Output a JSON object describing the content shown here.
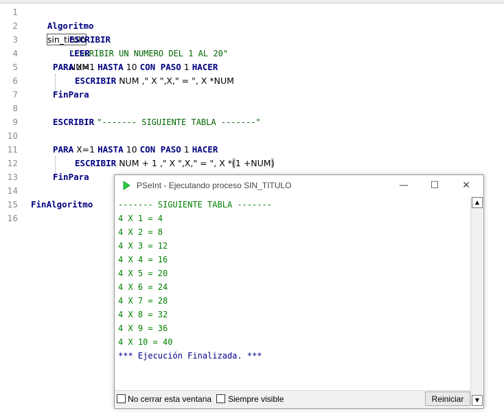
{
  "editor": {
    "lines": [
      {
        "n": "1"
      },
      {
        "n": "2"
      },
      {
        "n": "3"
      },
      {
        "n": "4"
      },
      {
        "n": "5"
      },
      {
        "n": "6"
      },
      {
        "n": "7"
      },
      {
        "n": "8"
      },
      {
        "n": "9"
      },
      {
        "n": "10"
      },
      {
        "n": "11"
      },
      {
        "n": "12"
      },
      {
        "n": "13"
      },
      {
        "n": "14"
      },
      {
        "n": "15"
      },
      {
        "n": "16"
      }
    ],
    "kw": {
      "algoritmo": "Algoritmo",
      "escribir": "ESCRIBIR",
      "leer": "LEER",
      "para": "PARA",
      "hasta": "HASTA",
      "con_paso": "CON PASO",
      "hacer": "HACER",
      "finpara": "FinPara",
      "finalgoritmo": "FinAlgoritmo"
    },
    "l1_name": "sin_titulo",
    "l2_str": "\"ESCRIBIR UN NUMERO DEL 1 AL 20\"",
    "l3_var": "NUM",
    "l5_var": "X=",
    "l5_from": "1",
    "l5_to": "10",
    "l5_step": "1",
    "l6_rest": "NUM ,\" X \",X,\" = \", X *NUM",
    "l9_str": "\"------- SIGUIENTE TABLA -------\"",
    "l11_var": "X=",
    "l11_from": "1",
    "l11_to": "10",
    "l11_step": "1",
    "l12_a": "NUM + ",
    "l12_one": "1",
    "l12_b": " ,\" X \",X,\" = \", X *",
    "l12_open": "(",
    "l12_one2": "1",
    "l12_c": " +NUM",
    "l12_close": ")"
  },
  "run_window": {
    "title": "PSeInt - Ejecutando proceso SIN_TITULO",
    "minimize": "—",
    "maximize": "☐",
    "close": "✕",
    "output": [
      "------- SIGUIENTE TABLA -------",
      "4 X 1 = 4",
      "4 X 2 = 8",
      "4 X 3 = 12",
      "4 X 4 = 16",
      "4 X 5 = 20",
      "4 X 6 = 24",
      "4 X 7 = 28",
      "4 X 8 = 32",
      "4 X 9 = 36",
      "4 X 10 = 40"
    ],
    "finished": "*** Ejecución Finalizada. ***",
    "no_cerrar": "No cerrar esta ventana",
    "siempre_visible": "Siempre visible",
    "reiniciar": "Reiniciar",
    "scroll_up": "▲",
    "scroll_down": "▼"
  },
  "colors": {
    "keyword": "#000080",
    "string": "#006400",
    "number": "#b35a00",
    "output": "#008000",
    "finished": "#00008b"
  },
  "icons": {
    "app": "pseint-play-icon"
  }
}
